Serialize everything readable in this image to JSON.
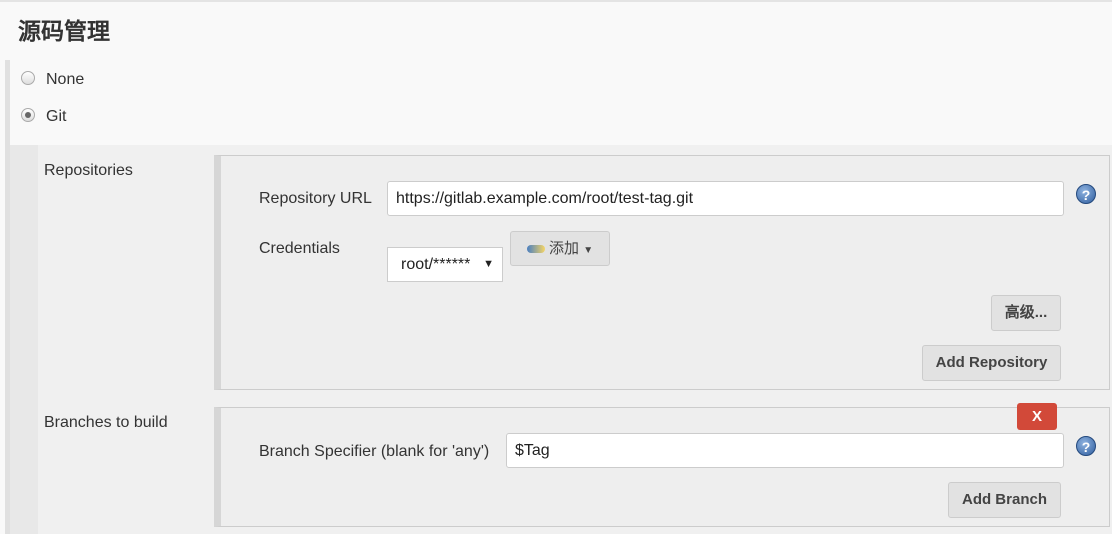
{
  "title": "源码管理",
  "scm_options": [
    {
      "label": "None",
      "selected": false
    },
    {
      "label": "Git",
      "selected": true
    }
  ],
  "repositories": {
    "label": "Repositories",
    "url_label": "Repository URL",
    "url_value": "https://gitlab.example.com/root/test-tag.git",
    "credentials_label": "Credentials",
    "credentials_value": "root/******",
    "add_label": "添加",
    "advanced_label": "高级...",
    "add_repository_label": "Add Repository",
    "help_icon": "question-circle-icon"
  },
  "branches": {
    "label": "Branches to build",
    "specifier_label": "Branch Specifier (blank for 'any')",
    "specifier_value": "$Tag",
    "delete_label": "X",
    "add_branch_label": "Add Branch"
  },
  "colors": {
    "delete_button": "#d24939",
    "help_icon": "#2f5d9e"
  }
}
